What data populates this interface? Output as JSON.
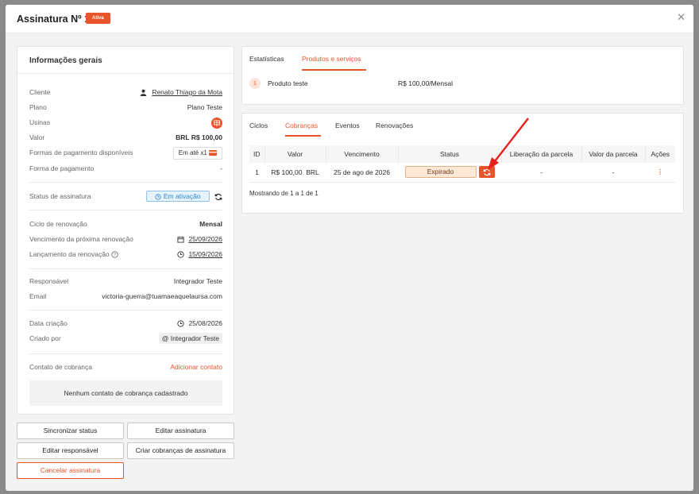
{
  "modal": {
    "title": "Assinatura Nº 1",
    "badge": "Ativa"
  },
  "general": {
    "title": "Informações gerais",
    "cliente_label": "Cliente",
    "cliente_value": "Renato Thiago da Mota",
    "plano_label": "Plano",
    "plano_value": "Plano Teste",
    "usinas_label": "Usinas",
    "valor_label": "Valor",
    "valor_value": "BRL R$ 100,00",
    "formas_label": "Formas de pagamento disponíveis",
    "formas_value": "Em até x1",
    "forma_label": "Forma de pagamento",
    "forma_value": "-",
    "status_label": "Status de assinatura",
    "status_value": "Em ativação",
    "ciclo_label": "Ciclo de renovação",
    "ciclo_value": "Mensal",
    "venc_label": "Vencimento da próxima renovação",
    "venc_value": "25/09/2026",
    "lanc_label": "Lançamento da renovação",
    "lanc_value": "15/09/2026",
    "resp_label": "Responsável",
    "resp_value": "Integrador Teste",
    "email_label": "Email",
    "email_value": "victoria-guerra@tuamaeaquelaursa.com",
    "data_label": "Data criação",
    "data_value": "25/08/2026",
    "criado_label": "Criado por",
    "criado_value": "Integrador Teste",
    "contato_label": "Contato de cobrança",
    "contato_link": "Adicionar contato",
    "no_contact": "Nenhum contato de cobrança cadastrado"
  },
  "buttons": {
    "sync": "Sincronizar status",
    "edit_sub": "Editar assinatura",
    "edit_resp": "Editar responsável",
    "create_charges": "Criar cobranças de assinatura",
    "cancel": "Cancelar assinatura"
  },
  "products": {
    "tabs": [
      "Estatísticas",
      "Produtos e serviços"
    ],
    "item_number": "1",
    "item_name": "Produto teste",
    "item_price": "R$ 100,00/Mensal"
  },
  "charges": {
    "tabs": [
      "Ciclos",
      "Cobranças",
      "Eventos",
      "Renovações"
    ],
    "headers": [
      "ID",
      "Valor",
      "Vencimento",
      "Status",
      "Liberação da parcela",
      "Valor da parcela",
      "Ações"
    ],
    "row": {
      "id": "1",
      "valor": "R$ 100,00  BRL",
      "vencimento": "25 de ago de 2026",
      "status": "Expirado",
      "liberacao": "-",
      "valor_parcela": "-",
      "acoes": "⋮"
    },
    "footer": "Mostrando de 1 a 1 de 1"
  },
  "colors": {
    "accent": "#e9542a",
    "status_blue": "#2d86c8"
  }
}
